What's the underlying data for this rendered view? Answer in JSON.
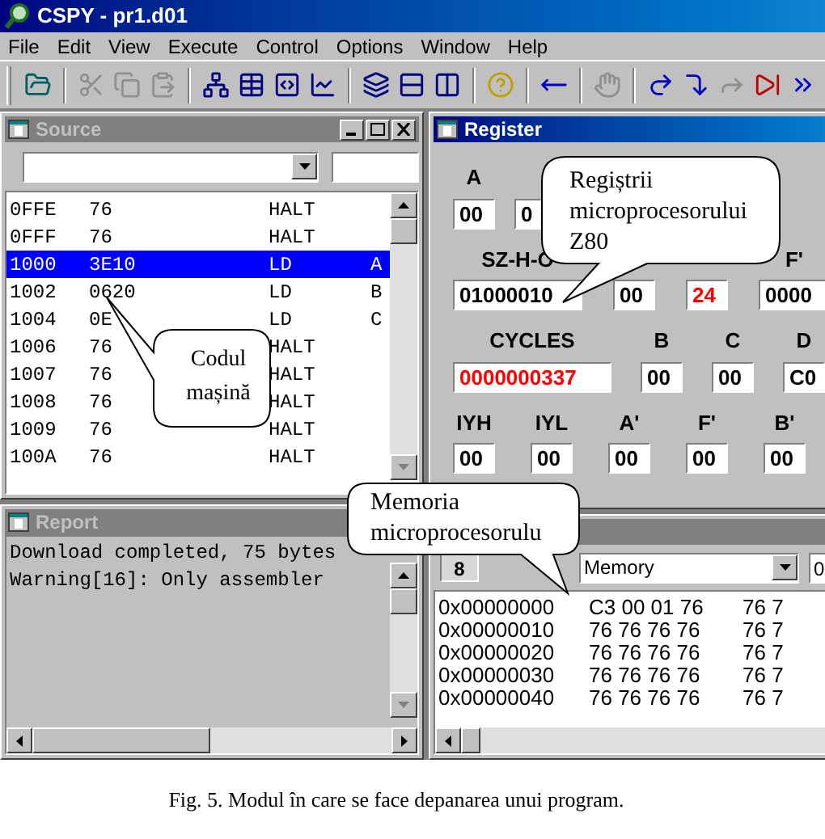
{
  "window": {
    "title": "CSPY - pr1.d01"
  },
  "menu": [
    "File",
    "Edit",
    "View",
    "Execute",
    "Control",
    "Options",
    "Window",
    "Help"
  ],
  "toolbar": [
    {
      "disabled": false
    },
    {
      "disabled": true
    },
    {
      "disabled": true
    },
    {
      "disabled": true
    },
    {
      "disabled": false
    },
    {
      "disabled": false
    },
    {
      "disabled": false
    },
    {
      "disabled": false
    },
    {
      "disabled": false
    },
    {
      "disabled": false
    },
    {
      "disabled": false
    },
    {
      "disabled": false
    },
    {
      "disabled": false
    },
    {
      "disabled": true
    },
    {
      "disabled": false
    },
    {
      "disabled": false
    },
    {
      "disabled": true
    },
    {
      "disabled": false
    },
    {
      "disabled": false
    }
  ],
  "source": {
    "title": "Source",
    "active": false,
    "rows": [
      {
        "address": "0FFE",
        "code": "76",
        "mnemonic": "HALT",
        "selected": false
      },
      {
        "address": "0FFF",
        "code": "76",
        "mnemonic": "HALT",
        "selected": false
      },
      {
        "address": "1000",
        "code": "3E10",
        "mnemonic": "LD",
        "operand": "A",
        "selected": true
      },
      {
        "address": "1002",
        "code": "0620",
        "mnemonic": "LD",
        "operand": "B",
        "selected": false
      },
      {
        "address": "1004",
        "code": "0E",
        "mnemonic": "LD",
        "operand": "C",
        "selected": false
      },
      {
        "address": "1006",
        "code": "76",
        "mnemonic": "HALT",
        "selected": false
      },
      {
        "address": "1007",
        "code": "76",
        "mnemonic": "HALT",
        "selected": false
      },
      {
        "address": "1008",
        "code": "76",
        "mnemonic": "HALT",
        "selected": false
      },
      {
        "address": "1009",
        "code": "76",
        "mnemonic": "HALT",
        "selected": false
      },
      {
        "address": "100A",
        "code": "76",
        "mnemonic": "HALT",
        "selected": false
      }
    ]
  },
  "register": {
    "title": "Register",
    "active": true,
    "rows": [
      {
        "fields": [
          {
            "label": "A",
            "value": "00",
            "changed": false
          },
          {
            "value": "0",
            "changed": false
          }
        ]
      },
      {
        "fields": [
          {
            "label": "SZ-H-O",
            "value": "01000010",
            "changed": false
          },
          {
            "value": "00",
            "changed": false
          },
          {
            "value": "24",
            "changed": true
          },
          {
            "label": "F'",
            "value": "0000",
            "changed": false
          }
        ]
      },
      {
        "fields": [
          {
            "label": "CYCLES",
            "value": "0000000337",
            "changed": true
          },
          {
            "label": "B",
            "value": "00",
            "changed": false
          },
          {
            "label": "C",
            "value": "00",
            "changed": false
          },
          {
            "label": "D",
            "value": "C0",
            "changed": false
          }
        ]
      },
      {
        "fields": [
          {
            "label": "IYH",
            "value": "00",
            "changed": false
          },
          {
            "label": "IYL",
            "value": "00",
            "changed": false
          },
          {
            "label": "A'",
            "value": "00",
            "changed": false
          },
          {
            "label": "F'",
            "value": "00",
            "changed": false
          },
          {
            "label": "B'",
            "value": "00",
            "changed": false
          }
        ]
      }
    ]
  },
  "report": {
    "title": "Report",
    "active": false,
    "lines": [
      "Download completed, 75 bytes",
      "Warning[16]: Only assembler"
    ]
  },
  "memory": {
    "size_button": "8",
    "view": "Memory",
    "address_field": "0",
    "rows": [
      {
        "address": "0x00000000",
        "group_1": "C3 00 01 76",
        "group_2": "76 7"
      },
      {
        "address": "0x00000010",
        "group_1": "76 76 76 76",
        "group_2": "76 7"
      },
      {
        "address": "0x00000020",
        "group_1": "76 76 76 76",
        "group_2": "76 7"
      },
      {
        "address": "0x00000030",
        "group_1": "76 76 76 76",
        "group_2": "76 7"
      },
      {
        "address": "0x00000040",
        "group_1": "76 76 76 76",
        "group_2": "76 7"
      }
    ]
  },
  "callouts": [
    {
      "text": "Codul mașină"
    },
    {
      "text": "Regiștrii microprocesorului Z80"
    },
    {
      "text": "Memoria microprocesorulu"
    }
  ],
  "caption": "Fig. 5. Modul în care se face depanarea unui program."
}
